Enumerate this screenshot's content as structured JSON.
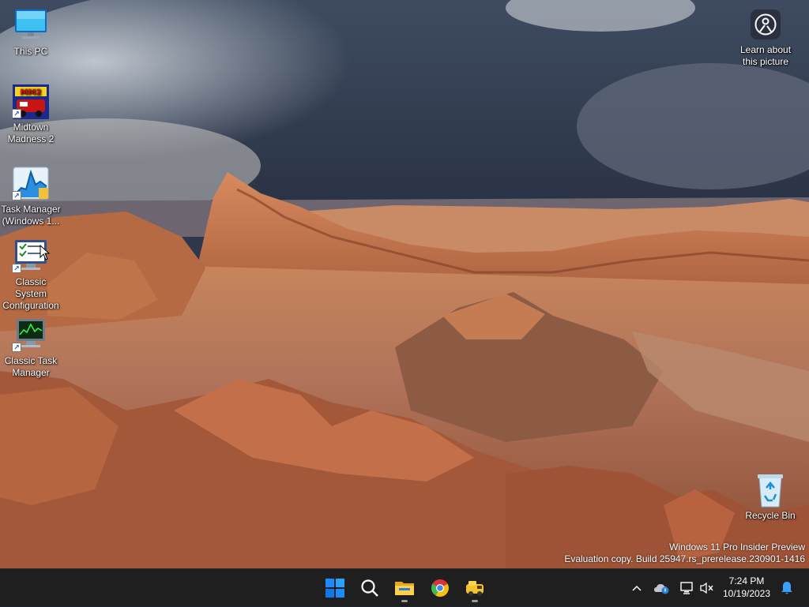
{
  "desktop": {
    "icons": [
      {
        "label": "This PC",
        "icon": "monitor-icon"
      },
      {
        "label": "Midtown Madness 2",
        "icon": "midtown-madness-2-icon"
      },
      {
        "label": "Task Manager (Windows 1...",
        "icon": "task-manager-icon"
      },
      {
        "label": "Classic System Configuration",
        "icon": "system-configuration-icon"
      },
      {
        "label": "Classic Task Manager",
        "icon": "classic-task-manager-icon"
      },
      {
        "label": "Recycle Bin",
        "icon": "recycle-bin-icon"
      }
    ],
    "learn_about": {
      "line1": "Learn about",
      "line2": "this picture",
      "icon": "camera-info-icon"
    },
    "watermark": {
      "line1": "Windows 11 Pro Insider Preview",
      "line2": "Evaluation copy. Build 25947.rs_prerelease.230901-1416"
    }
  },
  "taskbar": {
    "apps": [
      {
        "name": "Start",
        "icon": "windows-start-icon"
      },
      {
        "name": "Search",
        "icon": "search-icon"
      },
      {
        "name": "File Explorer",
        "icon": "file-explorer-icon",
        "running": true
      },
      {
        "name": "Google Chrome",
        "icon": "chrome-icon",
        "running": false
      },
      {
        "name": "Midtown Madness 2",
        "icon": "game-app-icon",
        "running": true
      }
    ],
    "tray": {
      "icons": [
        "chevron-up-icon",
        "onedrive-icon",
        "network-icon",
        "volume-muted-icon",
        "notification-bell-icon"
      ]
    },
    "clock": {
      "time": "7:24 PM",
      "date": "10/19/2023"
    }
  },
  "colors": {
    "taskbar": "#1f1f1f",
    "accent": "#1a8cff"
  }
}
